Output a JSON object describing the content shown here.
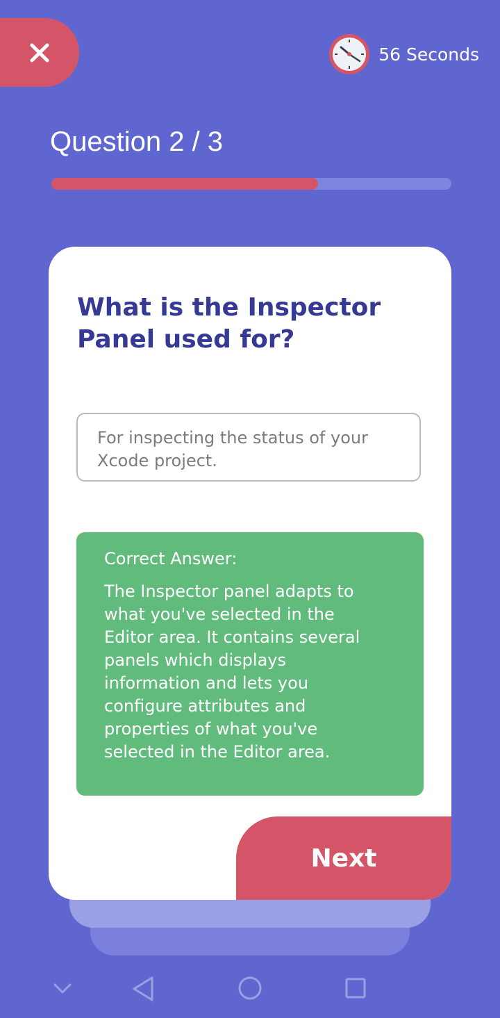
{
  "header": {
    "close_icon": "close-icon",
    "timer_icon": "clock-icon",
    "timer_text": "56 Seconds",
    "question_counter": "Question 2 / 3",
    "progress_fraction": 0.667
  },
  "card": {
    "question": "What is the Inspector Panel used for?",
    "selected_answer": "For inspecting the status of your Xcode project.",
    "correct_label": "Correct Answer:",
    "correct_text": "The Inspector panel adapts to what you've selected in the Editor area. It contains several panels which displays information and lets you configure attributes and properties of what you've selected in the Editor area.",
    "next_label": "Next"
  },
  "navbar": {
    "icons": [
      "chevron-down-icon",
      "back-triangle-icon",
      "home-circle-icon",
      "recents-square-icon"
    ]
  },
  "colors": {
    "background": "#6066cf",
    "accent_red": "#d45567",
    "correct_green": "#61bb7c",
    "question_text": "#363a94"
  }
}
